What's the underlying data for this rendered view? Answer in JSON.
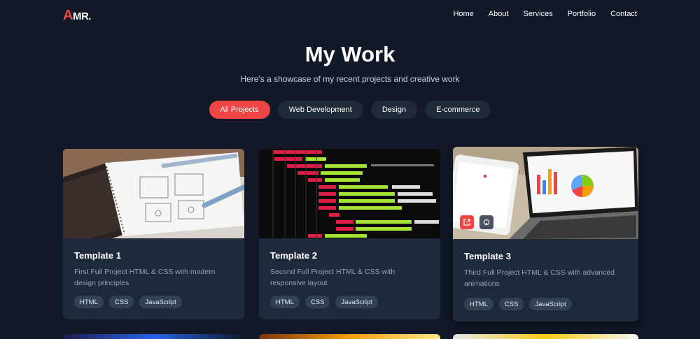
{
  "nav": {
    "logo_first": "A",
    "logo_rest": "MR.",
    "links": [
      "Home",
      "About",
      "Services",
      "Portfolio",
      "Contact"
    ]
  },
  "hero": {
    "title": "My Work",
    "subtitle": "Here's a showcase of my recent projects and creative work"
  },
  "filters": {
    "items": [
      "All Projects",
      "Web Development",
      "Design",
      "E-commerce"
    ],
    "active": "All Projects"
  },
  "projects": [
    {
      "title": "Template 1",
      "description": "First Full Project HTML & CSS with modern design principles",
      "tags": [
        "HTML",
        "CSS",
        "JavaScript"
      ]
    },
    {
      "title": "Template 2",
      "description": "Second Full Project HTML & CSS with responsive layout",
      "tags": [
        "HTML",
        "CSS",
        "JavaScript"
      ]
    },
    {
      "title": "Template 3",
      "description": "Third Full Project HTML & CSS with advanced animations",
      "tags": [
        "HTML",
        "CSS",
        "JavaScript"
      ]
    }
  ],
  "colors": {
    "background": "#111827",
    "card": "#1e293b",
    "accent": "#ef4444",
    "tag": "#334155",
    "muted_text": "#94a3b8"
  },
  "icons": {
    "overlay_link": "external-link-icon",
    "overlay_repo": "github-icon"
  }
}
